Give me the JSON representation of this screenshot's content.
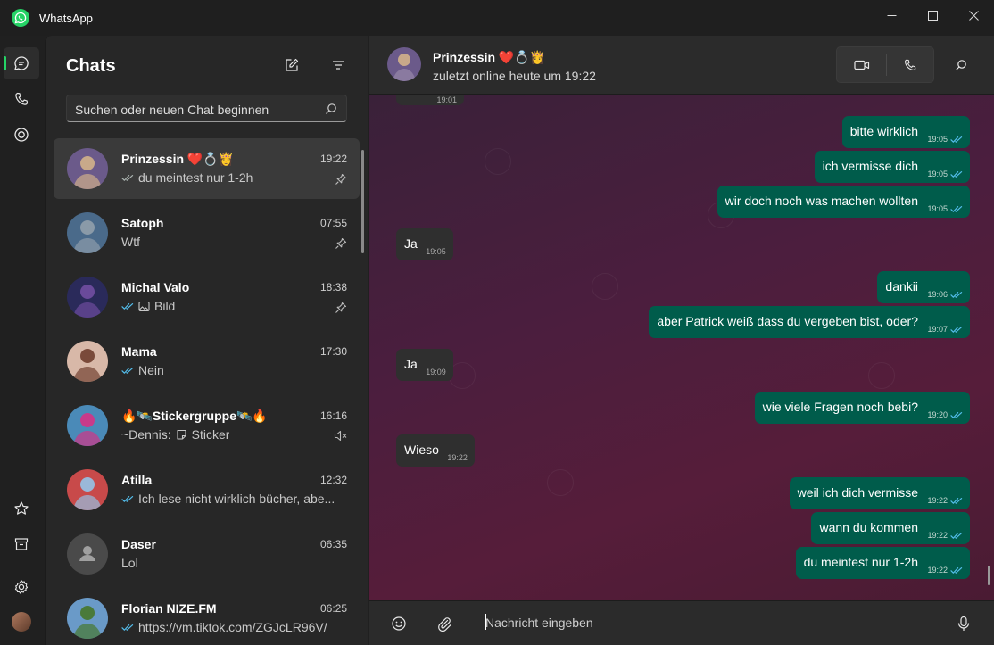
{
  "app": {
    "title": "WhatsApp"
  },
  "sidebar": {
    "title": "Chats",
    "search_placeholder": "Suchen oder neuen Chat beginnen"
  },
  "chats": [
    {
      "name": "Prinzessin ❤️💍👸",
      "time": "19:22",
      "preview": "du meintest nur 1-2h",
      "ticks": "read-grey",
      "pinned": true,
      "selected": true,
      "avatar_colors": [
        "#6b5a8a",
        "#c8a98a"
      ]
    },
    {
      "name": "Satoph",
      "time": "07:55",
      "preview": "Wtf",
      "ticks": "none",
      "pinned": true,
      "avatar_colors": [
        "#4a6a8a",
        "#8a9aa8"
      ]
    },
    {
      "name": "Michal Valo",
      "time": "18:38",
      "preview": "Bild",
      "ticks": "read-blue",
      "media": "image-icon",
      "pinned": true,
      "avatar_colors": [
        "#2a2a5a",
        "#6a4a9a"
      ]
    },
    {
      "name": "Mama",
      "time": "17:30",
      "preview": "Nein",
      "ticks": "read-blue",
      "avatar_colors": [
        "#d8b8a8",
        "#7a4a3a"
      ]
    },
    {
      "name": "🔥🛰️Stickergruppe🛰️🔥",
      "time": "16:16",
      "preview_sender": "~Dennis:",
      "preview": "Sticker",
      "media": "sticker-icon",
      "muted": true,
      "avatar_colors": [
        "#4a8ab8",
        "#c83a8a"
      ]
    },
    {
      "name": "Atilla",
      "time": "12:32",
      "preview": "Ich lese nicht wirklich bücher, abe...",
      "ticks": "read-blue",
      "avatar_colors": [
        "#c84a4a",
        "#9ab8d8"
      ]
    },
    {
      "name": "Daser",
      "time": "06:35",
      "preview": "Lol",
      "ticks": "none",
      "default_avatar": true
    },
    {
      "name": "Florian NIZE.FM",
      "time": "06:25",
      "preview": "https://vm.tiktok.com/ZGJcLR96V/",
      "ticks": "read-blue",
      "avatar_colors": [
        "#6a9ac8",
        "#4a7a3a"
      ]
    }
  ],
  "conversation": {
    "name": "Prinzessin ❤️💍👸",
    "status": "zuletzt online heute um 19:22",
    "composer_placeholder": "Nachricht eingeben",
    "messages": [
      {
        "dir": "in",
        "text": "",
        "time": "19:01",
        "partial": true
      },
      {
        "dir": "out",
        "text": "bitte wirklich",
        "time": "19:05"
      },
      {
        "dir": "out",
        "text": "ich vermisse dich",
        "time": "19:05"
      },
      {
        "dir": "out",
        "text": "wir doch noch was machen wollten",
        "time": "19:05"
      },
      {
        "dir": "in",
        "text": "Ja",
        "time": "19:05"
      },
      {
        "dir": "out",
        "text": "dankii",
        "time": "19:06"
      },
      {
        "dir": "out",
        "text": "aber Patrick weiß dass du vergeben bist, oder?",
        "time": "19:07"
      },
      {
        "dir": "in",
        "text": "Ja",
        "time": "19:09"
      },
      {
        "dir": "out",
        "text": "wie viele Fragen noch bebi?",
        "time": "19:20"
      },
      {
        "dir": "in",
        "text": "Wieso",
        "time": "19:22"
      },
      {
        "dir": "out",
        "text": "weil ich dich vermisse",
        "time": "19:22"
      },
      {
        "dir": "out",
        "text": "wann du kommen",
        "time": "19:22"
      },
      {
        "dir": "out",
        "text": "du meintest nur 1-2h",
        "time": "19:22"
      }
    ]
  },
  "colors": {
    "accent": "#25d366",
    "outgoing_bubble": "#005c4b",
    "incoming_bubble": "#2f2f2f",
    "read_tick": "#53bdeb"
  }
}
